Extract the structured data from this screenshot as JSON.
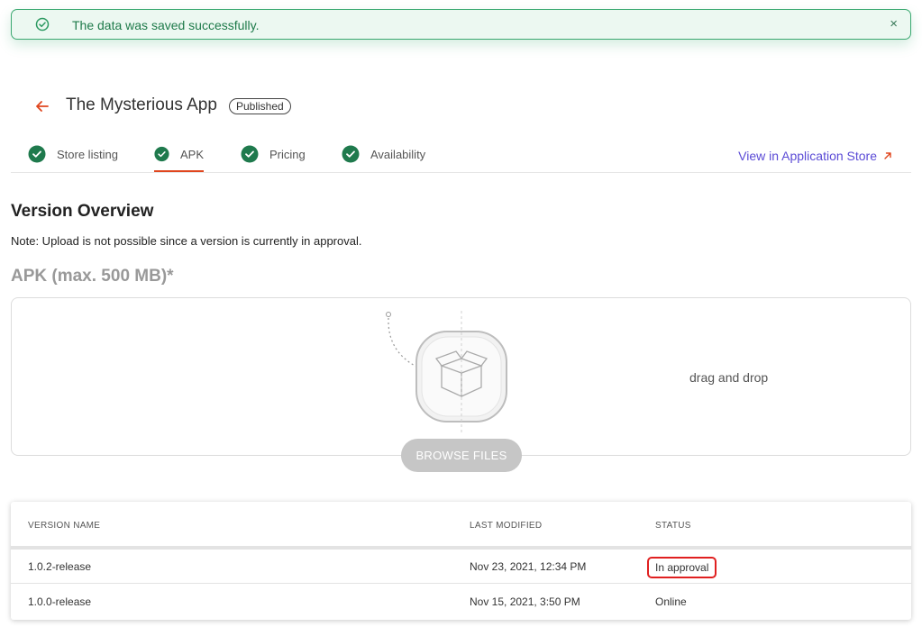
{
  "toast": {
    "message": "The data was saved successfully.",
    "close_label": "×",
    "color": "#1e7a4a"
  },
  "header": {
    "title": "The Mysterious App",
    "badge": "Published",
    "accent": "#e0461e"
  },
  "tabs": [
    {
      "label": "Store listing",
      "active": false
    },
    {
      "label": "APK",
      "active": true
    },
    {
      "label": "Pricing",
      "active": false
    },
    {
      "label": "Availability",
      "active": false
    }
  ],
  "store_link": "View in Application Store",
  "overview": {
    "title": "Version Overview",
    "note": "Note: Upload is not possible since a version is currently in approval.",
    "apk_label": "APK (max. 500 MB)*"
  },
  "upload": {
    "drag_text": "drag and drop",
    "browse_label": "BROWSE FILES"
  },
  "table": {
    "headers": [
      "VERSION NAME",
      "LAST MODIFIED",
      "STATUS"
    ],
    "rows": [
      {
        "name": "1.0.2-release",
        "modified": "Nov 23, 2021, 12:34 PM",
        "status": "In approval"
      },
      {
        "name": "1.0.0-release",
        "modified": "Nov 15, 2021, 3:50 PM",
        "status": "Online"
      }
    ]
  }
}
